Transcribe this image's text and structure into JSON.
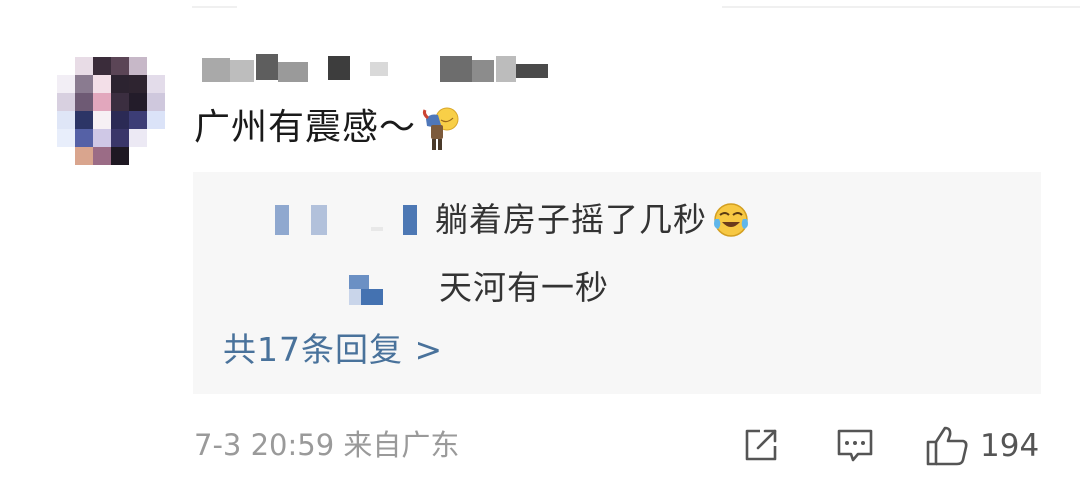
{
  "comment": {
    "text": "广州有震感～",
    "emoji_icon": "person-bowing-emoji-icon"
  },
  "replies": {
    "items": [
      {
        "text": "躺着房子摇了几秒",
        "emoji_icon": "laughing-crying-emoji-icon"
      },
      {
        "text": "天河有一秒"
      }
    ],
    "more_label": "共17条回复 >"
  },
  "meta": {
    "timestamp_location": "7-3 20:59 来自广东"
  },
  "actions": {
    "share_icon": "share-icon",
    "comment_icon": "comment-icon",
    "like_icon": "thumbs-up-icon",
    "like_count": "194"
  },
  "colors": {
    "text": "#1a1a1a",
    "link": "#49729b",
    "meta": "#9a9a9a",
    "reply_bg": "#f7f7f7"
  }
}
